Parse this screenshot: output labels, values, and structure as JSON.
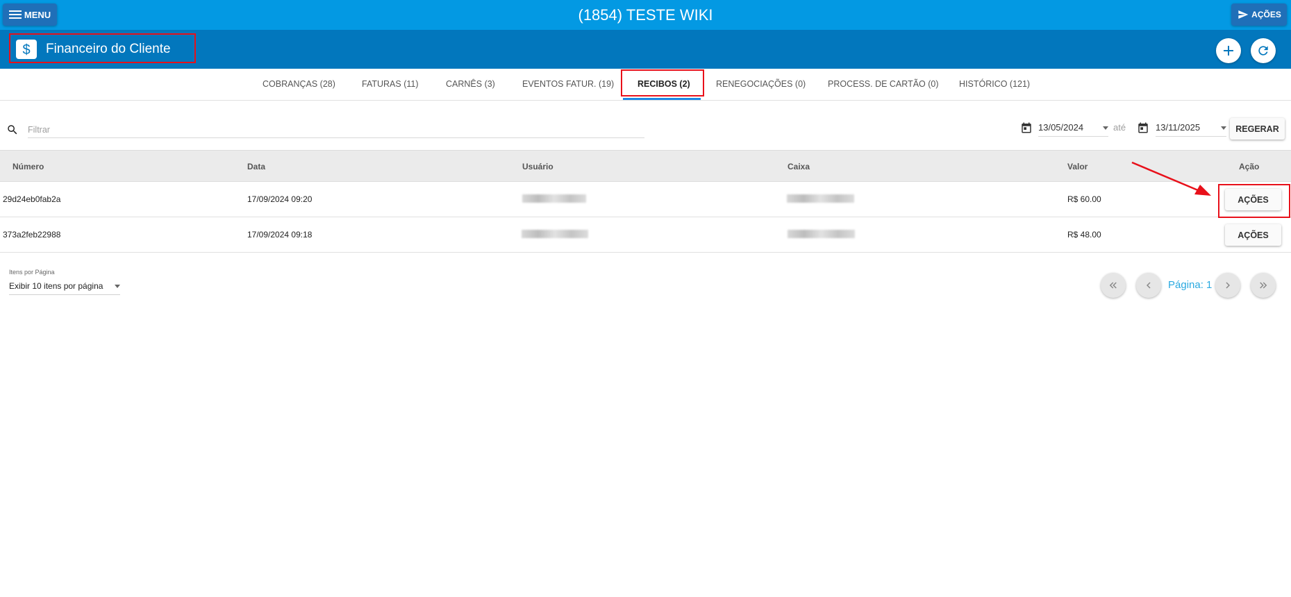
{
  "header": {
    "menu_label": "MENU",
    "title": "(1854) TESTE WIKI",
    "actions_label": "AÇÕES"
  },
  "module": {
    "title": "Financeiro do Cliente",
    "icon": "dollar-icon"
  },
  "tabs": [
    {
      "label": "COBRANÇAS (28)",
      "active": false
    },
    {
      "label": "FATURAS (11)",
      "active": false
    },
    {
      "label": "CARNÊS (3)",
      "active": false
    },
    {
      "label": "EVENTOS FATUR. (19)",
      "active": false
    },
    {
      "label": "RECIBOS (2)",
      "active": true
    },
    {
      "label": "RENEGOCIAÇÕES (0)",
      "active": false
    },
    {
      "label": "PROCESS. DE CARTÃO (0)",
      "active": false
    },
    {
      "label": "HISTÓRICO (121)",
      "active": false
    }
  ],
  "filter": {
    "placeholder": "Filtrar",
    "date_from": "13/05/2024",
    "date_separator": "até",
    "date_to": "13/11/2025",
    "regenerate_label": "REGERAR"
  },
  "table": {
    "columns": [
      "Número",
      "Data",
      "Usuário",
      "Caixa",
      "Valor",
      "Ação"
    ],
    "rows": [
      {
        "numero": "29d24eb0fab2a",
        "data": "17/09/2024 09:20",
        "valor": "R$ 60.00",
        "acao": "AÇÕES"
      },
      {
        "numero": "373a2feb22988",
        "data": "17/09/2024 09:18",
        "valor": "R$ 48.00",
        "acao": "AÇÕES"
      }
    ]
  },
  "pagination": {
    "per_page_label": "Itens por Página",
    "per_page_value": "Exibir 10 itens por página",
    "page_label": "Página: 1"
  },
  "colors": {
    "topbar": "#0399e3",
    "subbar": "#0277bd",
    "highlight": "#e8101a",
    "accent": "#1e88e5"
  }
}
